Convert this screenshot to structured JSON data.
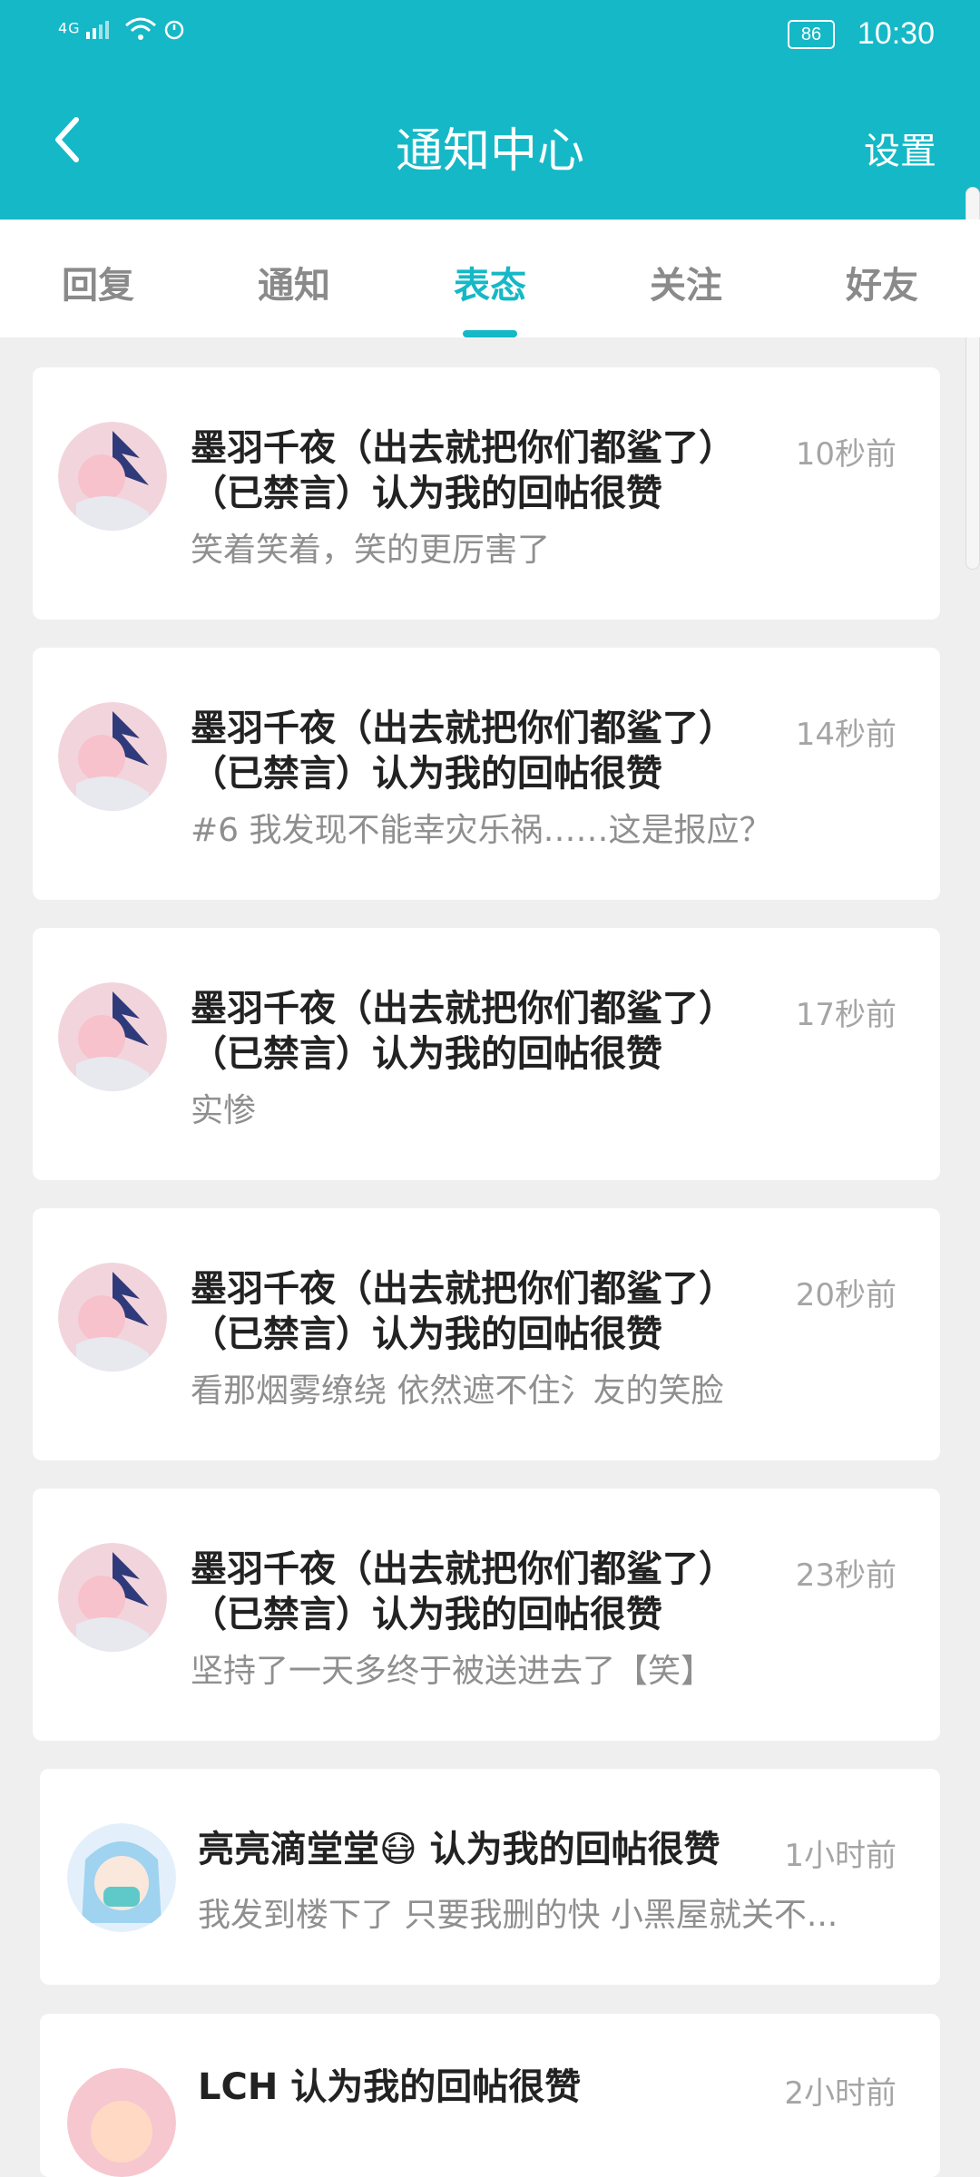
{
  "status_bar": {
    "network": "4G",
    "battery": "86",
    "time": "10:30"
  },
  "header": {
    "title": "通知中心",
    "settings_label": "设置",
    "back_icon": "chevron-left-icon",
    "bg_color": "#15b8c6"
  },
  "tabs": [
    {
      "label": "回复"
    },
    {
      "label": "通知"
    },
    {
      "label": "表态",
      "active": true
    },
    {
      "label": "关注"
    },
    {
      "label": "好友"
    }
  ],
  "notifications": [
    {
      "name_line1": "墨羽千夜（出去就把你们都鲨了）",
      "name_line2": "（已禁言）认为我的回帖很赞",
      "time": "10秒前",
      "snippet": "笑着笑着，笑的更厉害了"
    },
    {
      "name_line1": "墨羽千夜（出去就把你们都鲨了）",
      "name_line2": "（已禁言）认为我的回帖很赞",
      "time": "14秒前",
      "snippet": "#6 我发现不能幸灾乐祸……这是报应？"
    },
    {
      "name_line1": "墨羽千夜（出去就把你们都鲨了）",
      "name_line2": "（已禁言）认为我的回帖很赞",
      "time": "17秒前",
      "snippet": "实惨"
    },
    {
      "name_line1": "墨羽千夜（出去就把你们都鲨了）",
      "name_line2": "（已禁言）认为我的回帖很赞",
      "time": "20秒前",
      "snippet": "看那烟雾缭绕 依然遮不住氵友的笑脸"
    },
    {
      "name_line1": "墨羽千夜（出去就把你们都鲨了）",
      "name_line2": "（已禁言）认为我的回帖很赞",
      "time": "23秒前",
      "snippet": "坚持了一天多终于被送进去了【笑】"
    },
    {
      "name_line1": "亮亮滴堂堂😷 认为我的回帖很赞",
      "time": "1小时前",
      "snippet": "我发到楼下了 只要我删的快 小黑屋就关不..."
    },
    {
      "name_line1": "LCH 认为我的回帖很赞",
      "time": "2小时前"
    }
  ]
}
